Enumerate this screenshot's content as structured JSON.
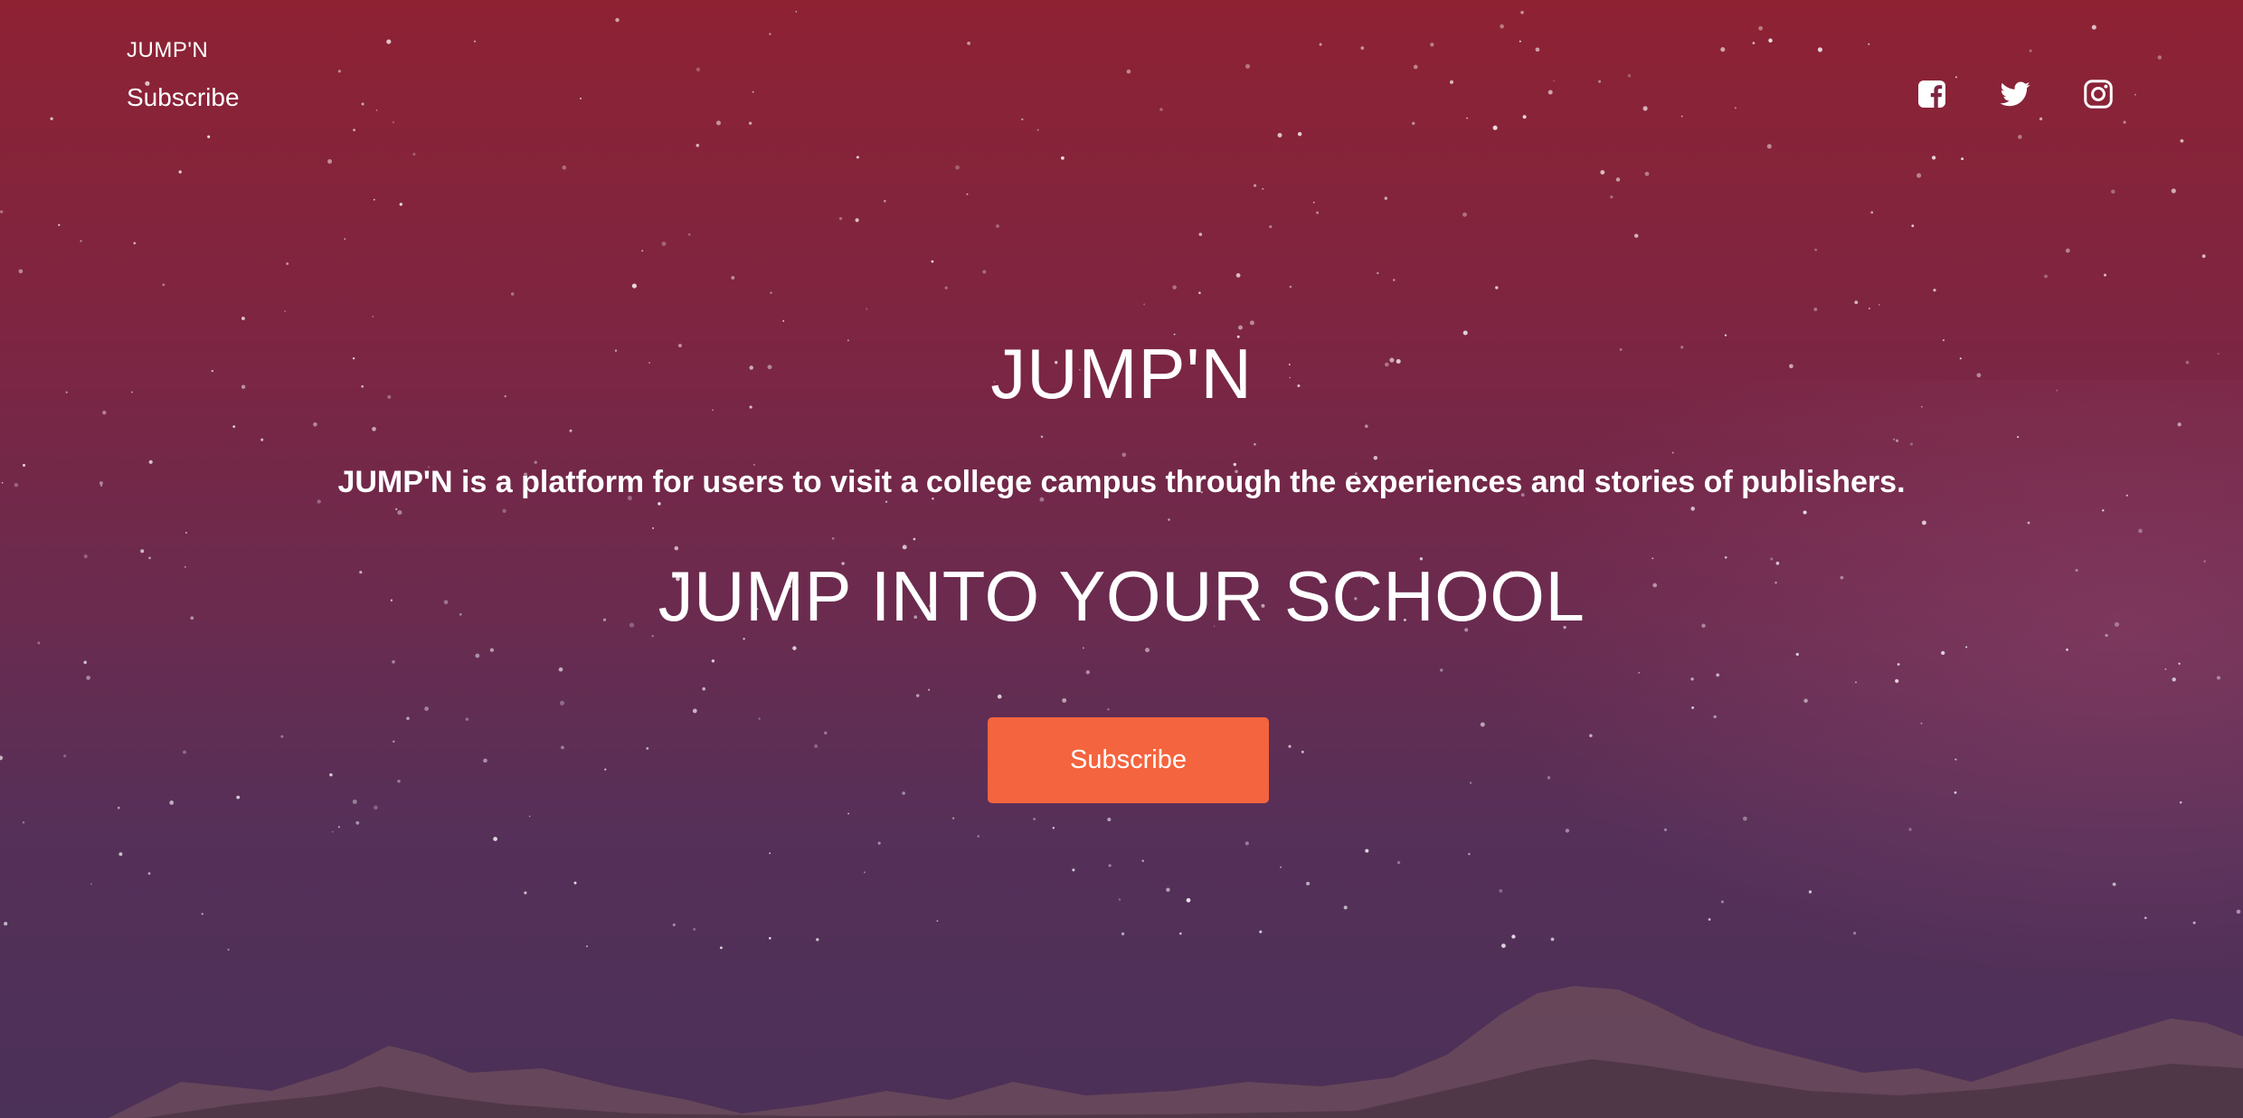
{
  "nav": {
    "brand": "JUMP'N",
    "subscribe_label": "Subscribe"
  },
  "social": [
    {
      "name": "facebook-icon"
    },
    {
      "name": "twitter-icon"
    },
    {
      "name": "instagram-icon"
    }
  ],
  "hero": {
    "title": "JUMP'N",
    "description": "JUMP'N is a platform for users to visit a college campus through the experiences and stories of publishers.",
    "tagline": "JUMP INTO YOUR SCHOOL",
    "cta_label": "Subscribe"
  },
  "colors": {
    "accent": "#f4643e",
    "background_top": "#8e2233",
    "background_bottom": "#4b3057",
    "text": "#ffffff"
  }
}
